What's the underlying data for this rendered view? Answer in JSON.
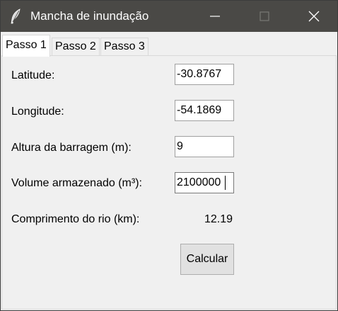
{
  "window": {
    "title": "Mancha de inundação",
    "icon": "feather-icon"
  },
  "titlebar_buttons": {
    "minimize_icon": "minimize-icon",
    "maximize_icon": "maximize-icon",
    "close_icon": "close-icon"
  },
  "tabs": [
    {
      "label": "Passo 1",
      "active": true
    },
    {
      "label": "Passo 2",
      "active": false
    },
    {
      "label": "Passo 3",
      "active": false
    }
  ],
  "form": {
    "latitude": {
      "label": "Latitude:",
      "value": "-30.8767"
    },
    "longitude": {
      "label": "Longitude:",
      "value": "-54.1869"
    },
    "altura": {
      "label": "Altura da barragem (m):",
      "value": "9"
    },
    "volume": {
      "label": "Volume armazenado (m³):",
      "value": "2100000"
    },
    "comprimento": {
      "label": "Comprimento do rio (km):",
      "value": "12.19"
    }
  },
  "actions": {
    "calcular_label": "Calcular"
  },
  "colors": {
    "titlebar_bg": "#4a4946",
    "window_bg": "#f0f0f0",
    "button_bg": "#e1e1e1"
  }
}
